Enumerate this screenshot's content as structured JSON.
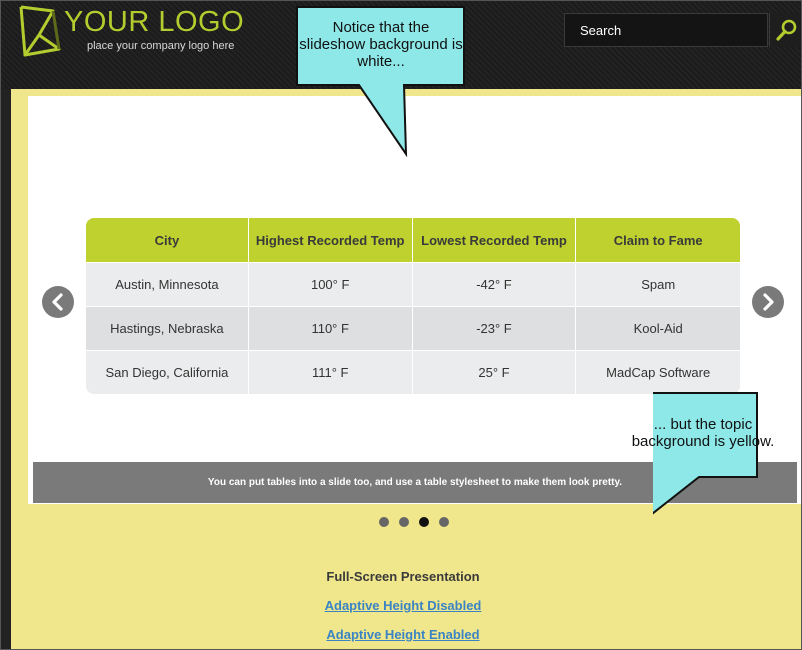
{
  "header": {
    "logo_title": "YOUR LOGO",
    "logo_subtitle": "place your company logo here",
    "search_placeholder": "Search",
    "search_icon": "magnifier-icon"
  },
  "slideshow": {
    "table": {
      "headers": [
        "City",
        "Highest Recorded Temp",
        "Lowest Recorded Temp",
        "Claim to Fame"
      ],
      "rows": [
        [
          "Austin, Minnesota",
          "100° F",
          "-42° F",
          "Spam"
        ],
        [
          "Hastings, Nebraska",
          "110° F",
          "-23° F",
          "Kool-Aid"
        ],
        [
          "San Diego, California",
          "111° F",
          "25° F",
          "MadCap Software"
        ]
      ]
    },
    "caption": "You can put tables into a slide too, and use a table stylesheet to make them look pretty.",
    "prev_icon": "chevron-left-icon",
    "next_icon": "chevron-right-icon",
    "slide_count": 4,
    "active_slide": 3
  },
  "links": {
    "heading": "Full-Screen Presentation",
    "items": [
      "Adaptive Height Disabled",
      "Adaptive Height Enabled"
    ]
  },
  "callouts": {
    "top": "Notice that the slideshow background is white...",
    "bottom": "... but the topic background is yellow."
  },
  "colors": {
    "accent": "#bed12e",
    "topic_background": "#f0e68c",
    "slide_background": "#ffffff",
    "callout_fill": "#8ee8e8",
    "link": "#3a84c4"
  }
}
